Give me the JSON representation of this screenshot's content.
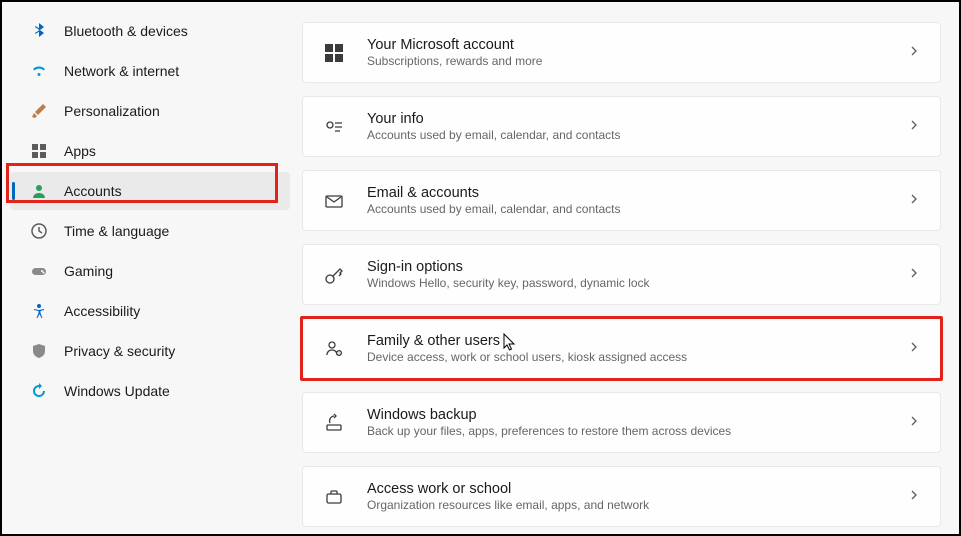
{
  "sidebar": {
    "items": [
      {
        "label": "Bluetooth & devices",
        "icon": "bluetooth"
      },
      {
        "label": "Network & internet",
        "icon": "wifi"
      },
      {
        "label": "Personalization",
        "icon": "brush"
      },
      {
        "label": "Apps",
        "icon": "apps"
      },
      {
        "label": "Accounts",
        "icon": "person",
        "selected": true
      },
      {
        "label": "Time & language",
        "icon": "clock"
      },
      {
        "label": "Gaming",
        "icon": "gamepad"
      },
      {
        "label": "Accessibility",
        "icon": "accessibility"
      },
      {
        "label": "Privacy & security",
        "icon": "shield"
      },
      {
        "label": "Windows Update",
        "icon": "update"
      }
    ]
  },
  "cards": [
    {
      "title": "Your Microsoft account",
      "sub": "Subscriptions, rewards and more",
      "icon": "microsoft"
    },
    {
      "title": "Your info",
      "sub": "Accounts used by email, calendar, and contacts",
      "icon": "id"
    },
    {
      "title": "Email & accounts",
      "sub": "Accounts used by email, calendar, and contacts",
      "icon": "mail"
    },
    {
      "title": "Sign-in options",
      "sub": "Windows Hello, security key, password, dynamic lock",
      "icon": "key"
    },
    {
      "title": "Family & other users",
      "sub": "Device access, work or school users, kiosk assigned access",
      "icon": "family",
      "highlighted": true
    },
    {
      "title": "Windows backup",
      "sub": "Back up your files, apps, preferences to restore them across devices",
      "icon": "backup"
    },
    {
      "title": "Access work or school",
      "sub": "Organization resources like email, apps, and network",
      "icon": "briefcase"
    }
  ],
  "colors": {
    "accent": "#0067c0",
    "highlight": "#e2231a"
  }
}
